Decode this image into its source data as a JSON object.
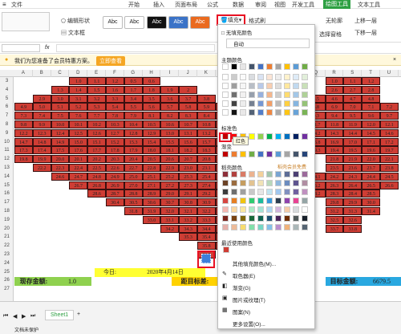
{
  "menubar": {
    "items": [
      "文件",
      "开始",
      "插入",
      "页面布局",
      "公式",
      "数据",
      "审阅",
      "视图",
      "开发工具",
      "会员专享",
      "绘图工具",
      "文本工具"
    ],
    "active": "绘图工具"
  },
  "ribbon": {
    "edit_shape": "编辑形状",
    "textbox": "文本框",
    "abc": "Abc",
    "fill": "填充",
    "format_brush": "格式刷",
    "no_outline": "无轮廓",
    "select_pane": "选择窗格",
    "bring_forward": "上移一层",
    "send_backward": "下移一层",
    "align": "对齐",
    "group": "组合",
    "rotate": "旋转"
  },
  "notice": {
    "text": "我们为您准备了会员特惠方案。",
    "button": "立即查看"
  },
  "columns": [
    "A",
    "B",
    "C",
    "D",
    "E",
    "F",
    "G",
    "H",
    "I",
    "J",
    "K",
    "L",
    "M",
    "N",
    "O",
    "P",
    "Q",
    "R",
    "S",
    "T",
    "U"
  ],
  "rows": [
    "3",
    "4",
    "5",
    "6",
    "7",
    "8",
    "9",
    "10",
    "11",
    "12",
    "13",
    "14",
    "15",
    "16",
    "17",
    "18",
    "19",
    "20",
    "21",
    "22",
    "23",
    "24",
    "25",
    "26",
    "27"
  ],
  "grid_values": {
    "r3": [
      "1.0",
      "1.1",
      "1.2",
      "0.5",
      "0.6"
    ],
    "r4": [
      "1.3",
      "1.4",
      "1.5",
      "1.6",
      "1.7",
      "1.8",
      "1.9",
      "2"
    ],
    "r5": [
      "2.9",
      "3.0",
      "3.1",
      "3.2",
      "3.3",
      "3.4",
      "3.5",
      "3.6",
      "3.7",
      "3.8"
    ],
    "r6": [
      "4.9",
      "5.0",
      "5.1",
      "5.2",
      "5.3",
      "5.4",
      "5.5",
      "5.6",
      "5.7",
      "5.8",
      "5.9",
      "6.0"
    ],
    "r7": [
      "7.3",
      "7.4",
      "7.5",
      "7.6",
      "7.7",
      "7.8",
      "7.9",
      "8.1",
      "8.2",
      "8.3",
      "8.4",
      "8.5"
    ],
    "r8": [
      "9.8",
      "9.9",
      "10.0",
      "10.1",
      "10.2",
      "10.3",
      "10.4",
      "10.5",
      "10.6",
      "10.7",
      "10.8",
      "10.9",
      "11.0"
    ],
    "r9": [
      "12.2",
      "12.3",
      "12.4",
      "12.5",
      "12.6",
      "12.7",
      "12.8",
      "12.9",
      "13.0",
      "13.1",
      "13.2",
      "13.3",
      "13.4"
    ],
    "r10": [
      "14.7",
      "14.8",
      "14.9",
      "15.0",
      "15.1",
      "15.2",
      "15.3",
      "15.4",
      "15.5",
      "15.6",
      "15.7",
      "15.8",
      "15.9"
    ],
    "r11": [
      "17.3",
      "17.4",
      "17.5",
      "17.6",
      "17.7",
      "17.8",
      "17.9",
      "18.0",
      "18.1",
      "18.2",
      "18.3",
      "18.4",
      "18.5"
    ],
    "r12": [
      "19.8",
      "19.9",
      "20.0",
      "20.1",
      "20.2",
      "20.3",
      "20.4",
      "20.5",
      "20.6",
      "20.7",
      "20.8",
      "20.9",
      "21.0"
    ],
    "r13": [
      "22.2",
      "22.3",
      "22.4",
      "22.5",
      "22.6",
      "22.7",
      "22.8",
      "22.9",
      "23.0",
      "23.1",
      "23.2",
      "23.3"
    ],
    "r14": [
      "24.6",
      "24.7",
      "24.8",
      "24.9",
      "25.0",
      "25.1",
      "25.2",
      "25.3",
      "25.4",
      "25.5",
      "25.6"
    ],
    "r15": [
      "26.7",
      "26.8",
      "26.9",
      "27.0",
      "27.1",
      "27.2",
      "27.3",
      "27.4",
      "27.5",
      "27.6"
    ],
    "r16": [
      "28.6",
      "28.7",
      "28.8",
      "28.9",
      "29.0",
      "29.1",
      "29.2",
      "29.3",
      "29.4"
    ],
    "r17": [
      "30.4",
      "30.5",
      "30.6",
      "30.7",
      "30.8",
      "30.9",
      "31.0",
      "31.1"
    ],
    "r18": [
      "31.8",
      "31.9",
      "32.0",
      "32.1",
      "32.2",
      "32.3",
      "32.4"
    ],
    "r19": [
      "33.0",
      "33.1",
      "33.2",
      "33.3",
      "33.4",
      "33.5"
    ],
    "r20": [
      "34.2",
      "34.3",
      "34.4",
      "34.5",
      "34.6"
    ],
    "r21": [
      "35.3",
      "35.4",
      "35.5",
      "35.6"
    ],
    "r22": [
      "35.8",
      "35.9",
      "36.0"
    ],
    "r23": [
      "36.5"
    ],
    "right_r3": [
      "1.0",
      "1.1",
      "1.2"
    ],
    "right_r4": [
      "2.6",
      "2.7",
      "2.8"
    ],
    "right_r5": [
      "4.5",
      "4.6",
      "4.7",
      "4.8"
    ],
    "right_r6": [
      "6.7",
      "6.8",
      "6.9",
      "7.0",
      "7.1",
      "7.2"
    ],
    "right_r7": [
      "9.2",
      "9.3",
      "9.4",
      "9.5",
      "9.6",
      "9.7"
    ],
    "right_r8": [
      "11.7",
      "11.8",
      "11.9",
      "12.0",
      "12.1"
    ],
    "right_r9": [
      "14.2",
      "14.3",
      "14.4",
      "14.5",
      "14.6"
    ],
    "right_r10": [
      "16.8",
      "16.9",
      "17.0",
      "17.1",
      "17.2"
    ],
    "right_r11": [
      "19.3",
      "19.4",
      "19.5",
      "19.6",
      "19.7"
    ],
    "right_r12": [
      "21.8",
      "21.9",
      "22.0",
      "22.1"
    ],
    "right_r13": [
      "23.5",
      "23.6",
      "23.7",
      "23.8"
    ],
    "right_r14": [
      "24.1",
      "24.2",
      "24.3",
      "24.4",
      "24.5"
    ],
    "right_r15": [
      "26.2",
      "26.3",
      "26.4",
      "26.5",
      "26.6"
    ],
    "right_r16": [
      "28.2",
      "28.3",
      "28.4",
      "28.5"
    ],
    "right_r17": [
      "29.8",
      "29.9",
      "30.0"
    ],
    "right_r18": [
      "31.2",
      "31.3",
      "31.4"
    ],
    "right_r19": [
      "32.5",
      "32.6"
    ],
    "right_r20": [
      "33.7",
      "33.8"
    ]
  },
  "summary": {
    "today_label": "今日:",
    "today_value": "2020年4月14日",
    "current_label": "现存金额:",
    "current_value": "1.0",
    "distance_label": "距目标差:",
    "target_label": "目标金额:",
    "target_value": "6679.5"
  },
  "palette": {
    "no_fill": "无填充颜色",
    "auto": "自动",
    "theme_colors": "主题颜色",
    "standard_colors": "标准色",
    "gradient": "渐变",
    "premium": "稻壳颜色",
    "premium_exclusive": "稻壳会员免费",
    "recent": "最近使用颜色",
    "tooltip": "红色",
    "items": [
      "其他填充颜色(M)...",
      "取色器(E)",
      "渐变(G)",
      "图片或纹理(T)",
      "图案(N)",
      "更多设置(O)..."
    ]
  },
  "sheet": {
    "tab": "Sheet1",
    "status": "文档未保护"
  },
  "colors": {
    "accent": "#2ea043",
    "cell_red": "#cf3d34",
    "today_bg": "#ffff33",
    "target_bg": "#29a8e0",
    "current_bg": "#8fd14f",
    "distance_bg": "#ffd200"
  }
}
